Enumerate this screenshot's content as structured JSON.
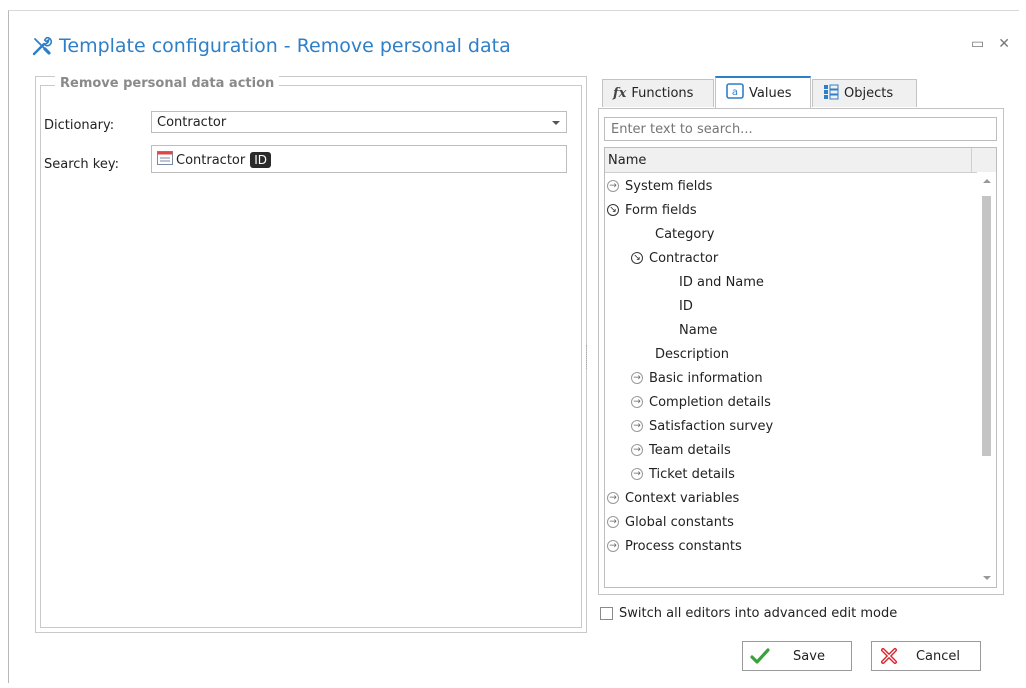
{
  "window": {
    "title": "Template configuration - Remove personal data",
    "maximize_icon": "maximize-icon",
    "close_icon": "close-icon"
  },
  "left": {
    "group_title": "Remove personal data action",
    "dictionary_label": "Dictionary:",
    "dictionary_value": "Contractor",
    "search_key_label": "Search key:",
    "search_key_token": "Contractor",
    "search_key_badge": "ID"
  },
  "tabs": [
    {
      "label": "Functions",
      "icon": "function-icon"
    },
    {
      "label": "Values",
      "icon": "values-icon",
      "active": true
    },
    {
      "label": "Objects",
      "icon": "objects-icon"
    }
  ],
  "values_panel": {
    "search_placeholder": "Enter text to search...",
    "column_header": "Name",
    "tree": [
      {
        "label": "System fields",
        "state": "collapsed"
      },
      {
        "label": "Form fields",
        "state": "expanded"
      },
      {
        "label": "Category",
        "state": "leaf"
      },
      {
        "label": "Contractor",
        "state": "expanded"
      },
      {
        "label": "ID and Name",
        "state": "leaf"
      },
      {
        "label": "ID",
        "state": "leaf"
      },
      {
        "label": "Name",
        "state": "leaf"
      },
      {
        "label": "Description",
        "state": "leaf"
      },
      {
        "label": "Basic information",
        "state": "collapsed"
      },
      {
        "label": "Completion details",
        "state": "collapsed"
      },
      {
        "label": "Satisfaction survey",
        "state": "collapsed"
      },
      {
        "label": "Team details",
        "state": "collapsed"
      },
      {
        "label": "Ticket details",
        "state": "collapsed"
      },
      {
        "label": "Context variables",
        "state": "collapsed"
      },
      {
        "label": "Global constants",
        "state": "collapsed"
      },
      {
        "label": "Process constants",
        "state": "collapsed"
      }
    ]
  },
  "advanced_mode_label": "Switch all editors into advanced edit mode",
  "buttons": {
    "save": "Save",
    "cancel": "Cancel"
  },
  "colors": {
    "accent": "#2f7fc8",
    "save_icon": "#3aa23a",
    "cancel_icon": "#d8282f"
  }
}
